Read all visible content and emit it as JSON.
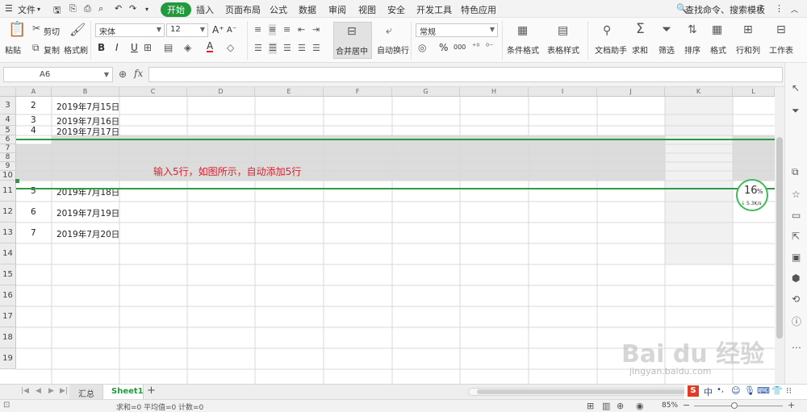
{
  "menubar": {
    "file": "文件",
    "tabs": [
      "开始",
      "插入",
      "页面布局",
      "公式",
      "数据",
      "审阅",
      "视图",
      "安全",
      "开发工具",
      "特色应用"
    ],
    "active_tab": "开始",
    "search": "查找命令、搜索模板",
    "help": "?"
  },
  "ribbon": {
    "cut": "剪切",
    "paste": "粘贴",
    "copy": "复制",
    "format_painter": "格式刷",
    "font_name": "宋体",
    "font_size": "12",
    "bold": "B",
    "italic": "I",
    "underline": "U",
    "font_color_letter": "A",
    "merge_center": "合并居中",
    "wrap_text": "自动换行",
    "number_format": "常规",
    "percent": "%",
    "thousands": "000",
    "cond_format": "条件格式",
    "table_style": "表格样式",
    "doc_helper": "文档助手",
    "sum": "求和",
    "filter": "筛选",
    "sort": "排序",
    "format": "格式",
    "row_col": "行和列",
    "worksheet": "工作表"
  },
  "formula_bar": {
    "name_box": "A6",
    "fx": "fx",
    "formula": ""
  },
  "columns": [
    "A",
    "B",
    "C",
    "D",
    "E",
    "F",
    "G",
    "H",
    "I",
    "J",
    "K",
    "L"
  ],
  "rows": [
    {
      "num": "3",
      "a": "2",
      "b": "2019年7月15日"
    },
    {
      "num": "4",
      "a": "3",
      "b": "2019年7月16日"
    },
    {
      "num": "5",
      "a": "4",
      "b": "2019年7月17日"
    },
    {
      "num": "6",
      "a": "",
      "b": ""
    },
    {
      "num": "7",
      "a": "",
      "b": ""
    },
    {
      "num": "8",
      "a": "",
      "b": ""
    },
    {
      "num": "9",
      "a": "",
      "b": ""
    },
    {
      "num": "10",
      "a": "",
      "b": ""
    },
    {
      "num": "11",
      "a": "5",
      "b": "2019年7月18日"
    },
    {
      "num": "12",
      "a": "6",
      "b": "2019年7月19日"
    },
    {
      "num": "13",
      "a": "7",
      "b": "2019年7月20日"
    },
    {
      "num": "14",
      "a": "",
      "b": ""
    },
    {
      "num": "15",
      "a": "",
      "b": ""
    },
    {
      "num": "16",
      "a": "",
      "b": ""
    },
    {
      "num": "17",
      "a": "",
      "b": ""
    },
    {
      "num": "18",
      "a": "",
      "b": ""
    },
    {
      "num": "19",
      "a": "",
      "b": ""
    }
  ],
  "annotation": "输入5行，如图所示，自动添加5行",
  "network_widget": {
    "percent": "16",
    "percent_sign": "%",
    "speed": "5.3K/s"
  },
  "sheet_tabs": [
    "汇总",
    "Sheet1"
  ],
  "active_sheet": "Sheet1",
  "add_sheet": "+",
  "status": {
    "sum": "求和=0",
    "avg": "平均值=0",
    "count": "计数=0",
    "zoom": "85%"
  },
  "watermark": {
    "brand": "Bai du 经验",
    "url": "jingyan.baidu.com"
  },
  "ime": {
    "lang": "中"
  },
  "colors": {
    "accent": "#1f9a3c",
    "selection": "#dcdcdc",
    "annotation": "#d9232e"
  }
}
